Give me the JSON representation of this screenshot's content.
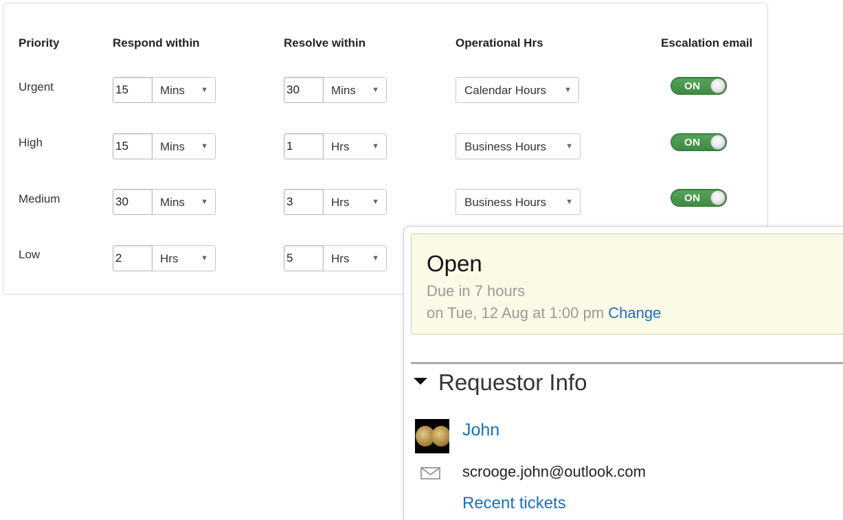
{
  "sla_table": {
    "headers": {
      "priority": "Priority",
      "respond": "Respond within",
      "resolve": "Resolve within",
      "operational": "Operational Hrs",
      "escalation": "Escalation email"
    },
    "rows": [
      {
        "priority": "Urgent",
        "respond_value": "15",
        "respond_unit": "Mins",
        "resolve_value": "30",
        "resolve_unit": "Mins",
        "operational": "Calendar Hours",
        "escalation": "ON"
      },
      {
        "priority": "High",
        "respond_value": "15",
        "respond_unit": "Mins",
        "resolve_value": "1",
        "resolve_unit": "Hrs",
        "operational": "Business Hours",
        "escalation": "ON"
      },
      {
        "priority": "Medium",
        "respond_value": "30",
        "respond_unit": "Mins",
        "resolve_value": "3",
        "resolve_unit": "Hrs",
        "operational": "Business Hours",
        "escalation": "ON"
      },
      {
        "priority": "Low",
        "respond_value": "2",
        "respond_unit": "Hrs",
        "resolve_value": "5",
        "resolve_unit": "Hrs"
      }
    ],
    "caret_glyph": "▼"
  },
  "ticket": {
    "status": "Open",
    "due_text": "Due in 7 hours",
    "due_when": "on Tue, 12 Aug at 1:00 pm",
    "change_link": "Change",
    "requestor_section": "Requestor Info",
    "requestor_name": "John",
    "requestor_email": "scrooge.john@outlook.com",
    "recent_tickets_link": "Recent tickets"
  },
  "colors": {
    "link": "#1a6fbf",
    "toggle_on": "#4a9a50",
    "status_bg": "#fbfae6"
  },
  "icons": {
    "section_toggle": "caret-down-icon",
    "email": "mail-icon",
    "select_arrow": "chevron-down-icon"
  }
}
